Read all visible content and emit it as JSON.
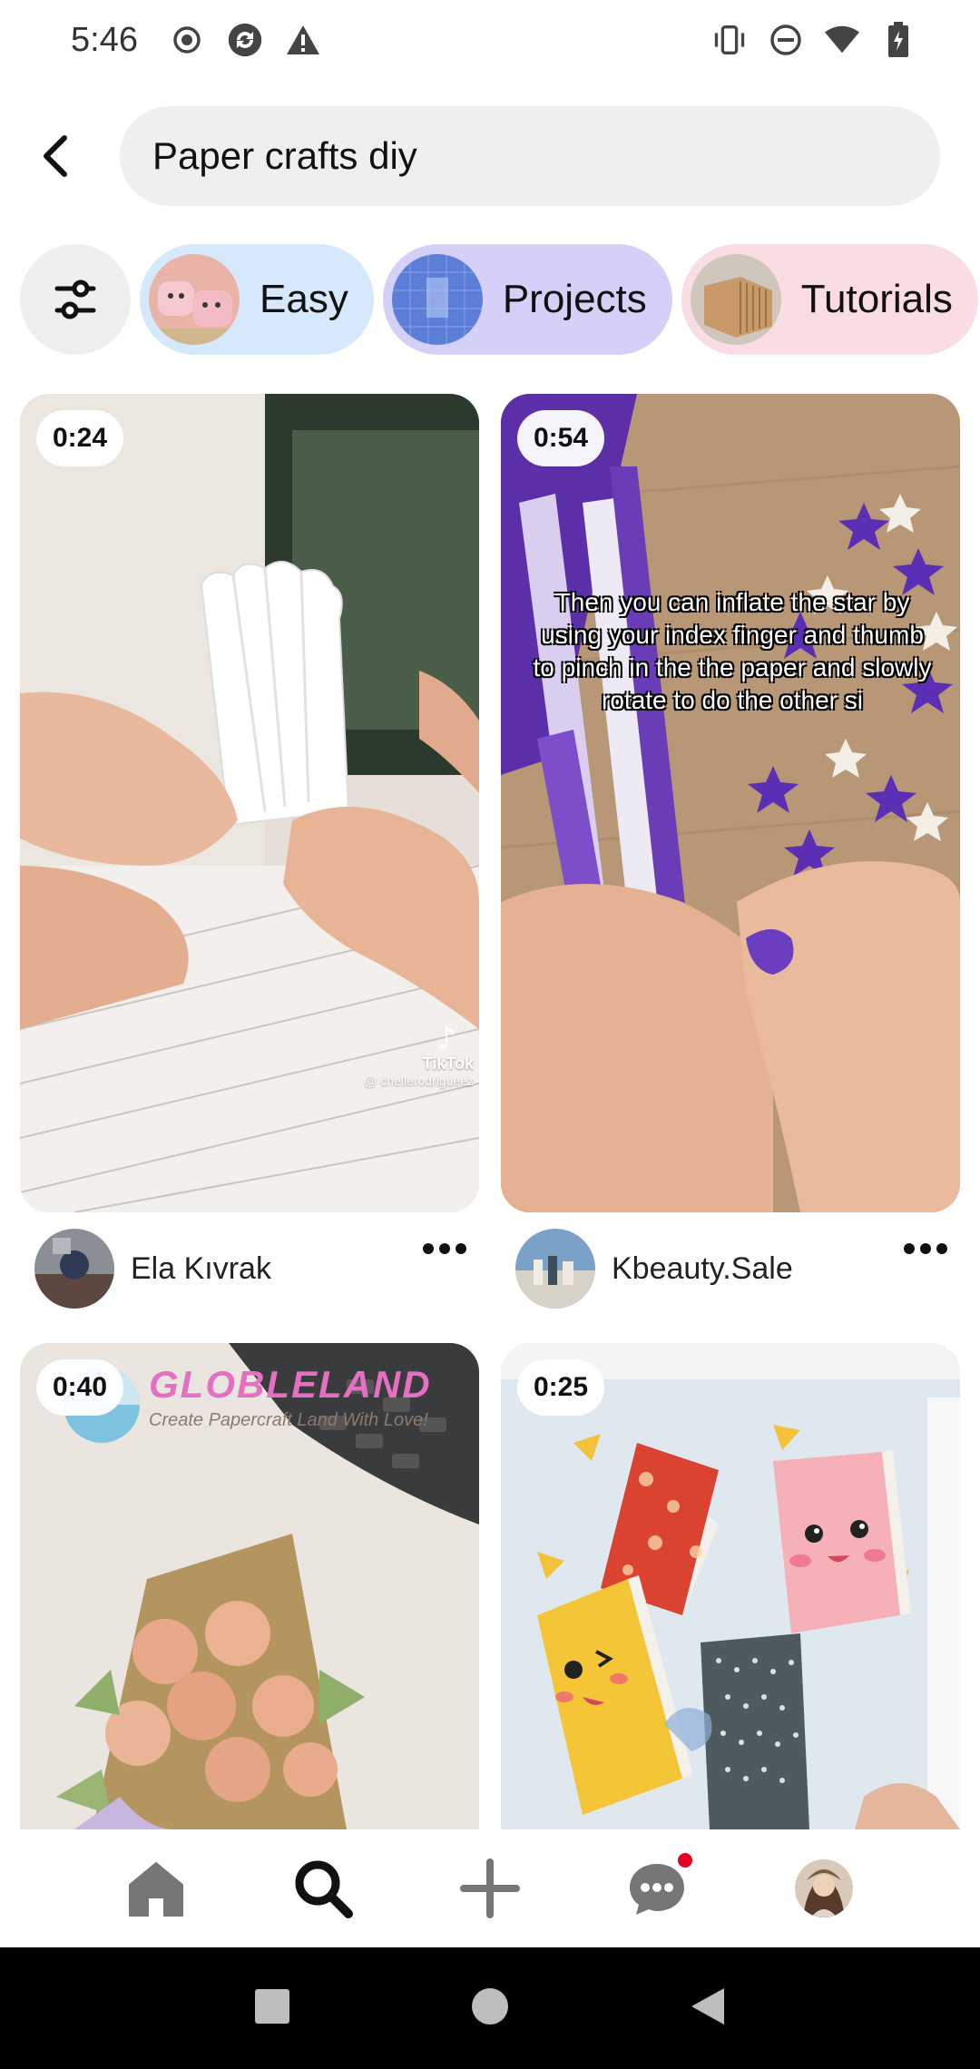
{
  "status_bar": {
    "time": "5:46",
    "left_icons": [
      "record-icon",
      "sync-icon",
      "warning-icon"
    ],
    "right_icons": [
      "vibrate-icon",
      "do-not-disturb-icon",
      "wifi-icon",
      "battery-icon"
    ]
  },
  "search": {
    "query": "Paper crafts diy"
  },
  "chips": [
    {
      "label": "Easy",
      "bg": "#d6e8fb"
    },
    {
      "label": "Projects",
      "bg": "#d4d0f7"
    },
    {
      "label": "Tutorials",
      "bg": "#f9dde3"
    }
  ],
  "pins": [
    {
      "duration": "0:24",
      "creator": "Ela Kıvrak",
      "watermark_brand": "TikTok",
      "watermark_handle": "@ chellerodrigueez"
    },
    {
      "duration": "0:54",
      "creator": "Kbeauty.Sale",
      "overlay_text": "Then you can inflate the star by using your index finger and thumb to pinch in the the paper and slowly rotate to do the other si"
    },
    {
      "duration": "0:40",
      "logo_text": "GLOBLELAND",
      "logo_subtext": "Create Papercraft Land With Love!"
    },
    {
      "duration": "0:25"
    }
  ],
  "nav": {
    "items": [
      "home-icon",
      "search-icon",
      "create-icon",
      "messages-icon",
      "profile-avatar"
    ],
    "active": "search-icon"
  },
  "colors": {
    "accent": "#e60023",
    "search_bg": "#efefef"
  }
}
